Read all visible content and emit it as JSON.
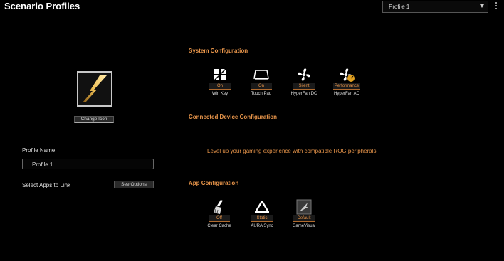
{
  "header": {
    "title": "Scenario Profiles",
    "profile_selected": "Profile 1"
  },
  "left": {
    "change_icon_label": "Change Icon",
    "profile_name_label": "Profile Name",
    "profile_name_value": "Profile 1",
    "select_apps_label": "Select Apps to Link",
    "see_options_label": "See Options"
  },
  "system": {
    "title": "System Configuration",
    "items": [
      {
        "icon": "windows-key-icon",
        "state": "On",
        "label": "Win Key"
      },
      {
        "icon": "touchpad-icon",
        "state": "On",
        "label": "Touch Pad"
      },
      {
        "icon": "fan-icon",
        "state": "Silent",
        "label": "HyperFan DC"
      },
      {
        "icon": "fan-performance-icon",
        "state": "Performance",
        "label": "HyperFan AC"
      }
    ]
  },
  "connected": {
    "title": "Connected Device Configuration",
    "message": "Level up your gaming experience with compatible ROG peripherals."
  },
  "apps": {
    "title": "App Configuration",
    "items": [
      {
        "icon": "clear-cache-icon",
        "state": "Off",
        "label": "Clear Cache"
      },
      {
        "icon": "aura-sync-icon",
        "state": "Static",
        "label": "AURA Sync"
      },
      {
        "icon": "gamevisual-icon",
        "state": "Default",
        "label": "GameVisual"
      }
    ]
  },
  "colors": {
    "accent": "#e8954a",
    "background": "#000000"
  }
}
